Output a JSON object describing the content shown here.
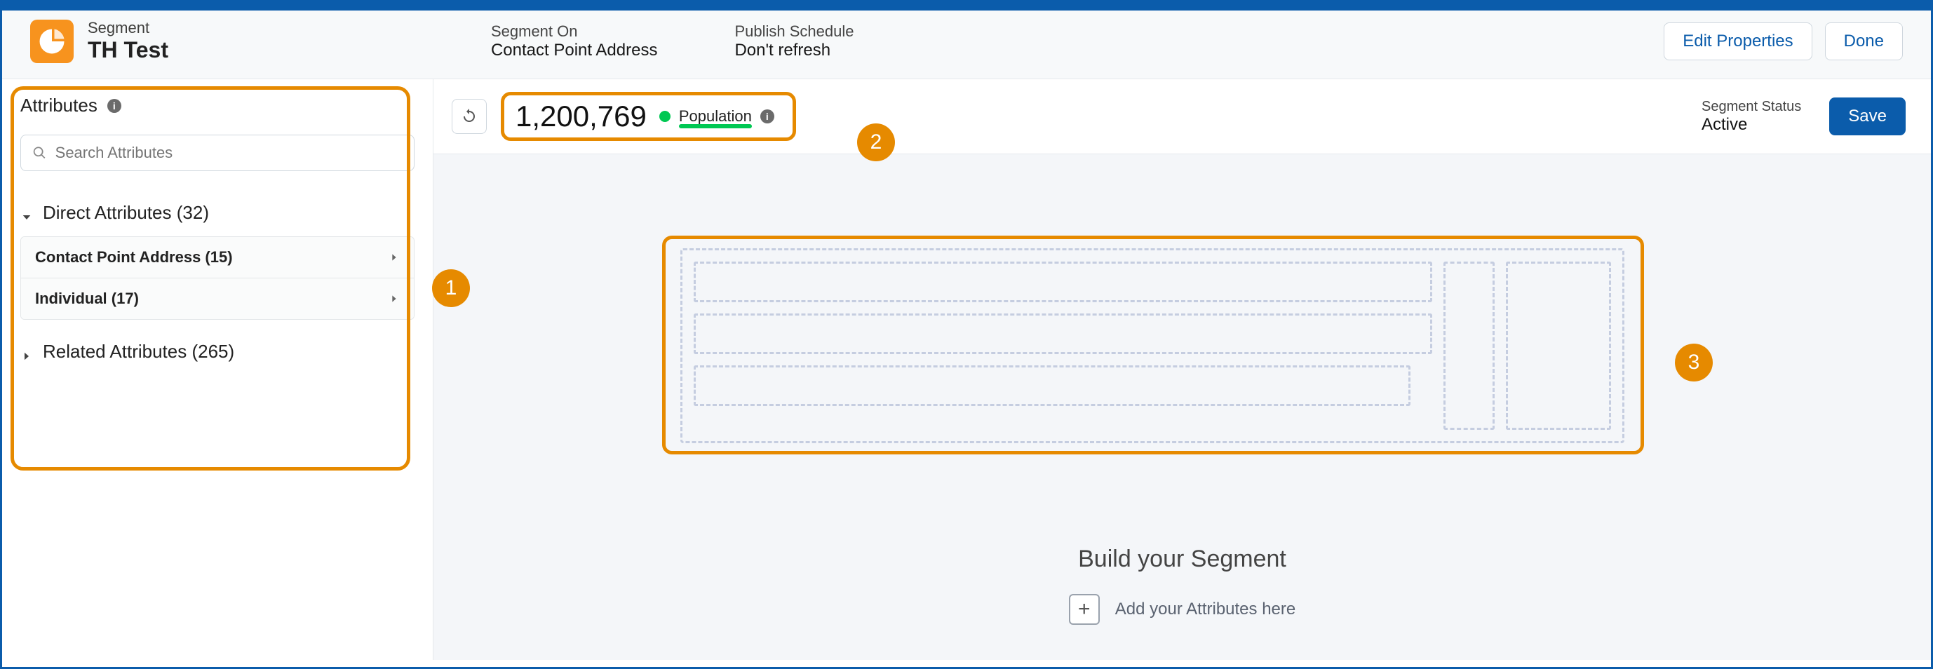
{
  "header": {
    "eyebrow": "Segment",
    "title": "TH Test",
    "meta": [
      {
        "label": "Segment On",
        "value": "Contact Point Address"
      },
      {
        "label": "Publish Schedule",
        "value": "Don't refresh"
      }
    ],
    "edit_label": "Edit Properties",
    "done_label": "Done"
  },
  "sidebar": {
    "panel_title": "Attributes",
    "search_placeholder": "Search Attributes",
    "groups": [
      {
        "label": "Direct Attributes (32)",
        "expanded": true,
        "items": [
          {
            "label": "Contact Point Address (15)"
          },
          {
            "label": "Individual (17)"
          }
        ]
      },
      {
        "label": "Related Attributes (265)",
        "expanded": false,
        "items": []
      }
    ]
  },
  "stats": {
    "count": "1,200,769",
    "pop_label": "Population",
    "status_label": "Segment Status",
    "status_value": "Active",
    "save_label": "Save"
  },
  "canvas": {
    "build_title": "Build your Segment",
    "add_hint": "Add your Attributes here"
  },
  "callouts": {
    "c1": "1",
    "c2": "2",
    "c3": "3"
  }
}
